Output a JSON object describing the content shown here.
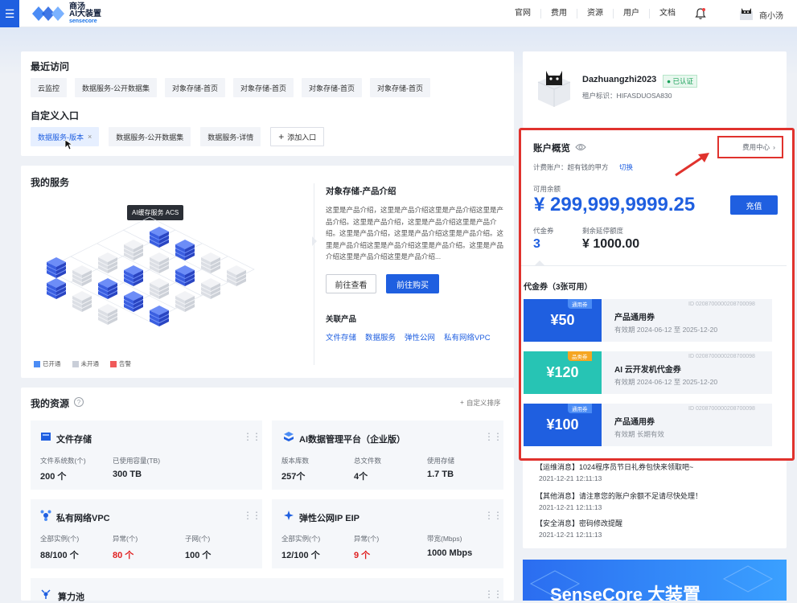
{
  "header": {
    "logo_line1": "商汤",
    "logo_line2": "AI大装置",
    "logo_sub": "sensecore",
    "nav": [
      "官网",
      "费用",
      "资源",
      "用户",
      "文档"
    ],
    "user_name": "商小汤"
  },
  "recent": {
    "title": "最近访问",
    "items": [
      "云监控",
      "数据服务-公开数据集",
      "对象存储-首页",
      "对象存储-首页",
      "对象存储-首页",
      "对象存储-首页"
    ]
  },
  "custom": {
    "title": "自定义入口",
    "items": [
      "数据服务-版本",
      "数据服务-公开数据集",
      "数据服务-详情"
    ],
    "close_glyph": "×",
    "add_label": "添加入口",
    "add_glyph": "+"
  },
  "services": {
    "title": "我的服务",
    "tooltip": "AI缓存服务 ACS",
    "legend": [
      {
        "label": "已开通",
        "color": "#4b8cf5"
      },
      {
        "label": "未开通",
        "color": "#c9ced8"
      },
      {
        "label": "告警",
        "color": "#f05a5a"
      }
    ],
    "detail_title": "对象存储-产品介绍",
    "detail_text": "这里是产品介绍，这里是产品介绍这里是产品介绍这里是产品介绍。这里是产品介绍，这里是产品介绍这里是产品介绍。这里是产品介绍，这里是产品介绍这里是产品介绍。这里是产品介绍这里是产品介绍这里是产品介绍。这里是产品介绍这里是产品介绍这里是产品介绍...",
    "btn_view": "前往查看",
    "btn_buy": "前往购买",
    "related_title": "关联产品",
    "related": [
      "文件存储",
      "数据服务",
      "弹性公网",
      "私有网络VPC"
    ]
  },
  "resources": {
    "title": "我的资源",
    "help_glyph": "?",
    "sort_label": "自定义排序",
    "sort_glyph": "+",
    "drag_glyph": "⋮⋮",
    "tiles": [
      {
        "name": "文件存储",
        "stats": [
          {
            "label": "文件系统数(个)",
            "value": "200 个"
          },
          {
            "label": "已使用容量(TB)",
            "value": "300 TB"
          }
        ]
      },
      {
        "name": "AI数据管理平台（企业版）",
        "stats": [
          {
            "label": "版本库数",
            "value": "257个"
          },
          {
            "label": "总文件数",
            "value": "4个"
          },
          {
            "label": "使用存储",
            "value": "1.7 TB"
          }
        ]
      },
      {
        "name": "私有网络VPC",
        "stats": [
          {
            "label": "全部实例(个)",
            "value": "88/100 个"
          },
          {
            "label": "异常(个)",
            "value": "80 个"
          },
          {
            "label": "子网(个)",
            "value": "100 个"
          }
        ]
      },
      {
        "name": "弹性公网IP EIP",
        "stats": [
          {
            "label": "全部实例(个)",
            "value": "12/100 个"
          },
          {
            "label": "异常(个)",
            "value": "9 个"
          },
          {
            "label": "带宽(Mbps)",
            "value": "1000 Mbps"
          }
        ]
      },
      {
        "name": "算力池",
        "stats": []
      }
    ]
  },
  "profile": {
    "name": "Dazhuangzhi2023",
    "verified": "已认证",
    "tenant": "租户标识：HIFASDUOSA830"
  },
  "account": {
    "title": "账户概览",
    "fee_center": "费用中心",
    "fee_arrow": "›",
    "billing_label": "计费账户：超有钱的甲方",
    "switch": "切换",
    "balance_label": "可用余额",
    "balance": "¥ 299,999,9999.25",
    "recharge": "充值",
    "coupon_label": "代金券",
    "coupon_count": "3",
    "credit_label": "剩余延停额度",
    "credit": "¥ 1000.00"
  },
  "vouchers": {
    "title": "代金券（3张可用）",
    "items": [
      {
        "amount": "¥50",
        "tag": "通用券",
        "name": "产品通用券",
        "validity": "有效期 2024-06-12 至 2025-12-20",
        "id": "ID 0208700000208700098",
        "color": "#1f5fe0"
      },
      {
        "amount": "¥120",
        "tag": "品类券",
        "name": "AI 云开发机代金券",
        "validity": "有效期 2024-06-12 至 2025-12-20",
        "id": "ID 0208700000208700098",
        "color": "#27c4b4"
      },
      {
        "amount": "¥100",
        "tag": "通用券",
        "name": "产品通用券",
        "validity": "有效期 长期有效",
        "id": "ID 0208700000208700098",
        "color": "#1f5fe0"
      }
    ]
  },
  "messages": [
    {
      "text": "【运维消息】1024程序员节日礼券包快来领取吧~",
      "date": "2021-12-21  12:11:13"
    },
    {
      "text": "【其他消息】请注意您的账户余额不足请尽快处理！",
      "date": "2021-12-21  12:11:13"
    },
    {
      "text": "【安全消息】密码修改提醒",
      "date": "2021-12-21  12:11:13"
    }
  ],
  "banner": {
    "text": "SenseCore 大装置"
  }
}
